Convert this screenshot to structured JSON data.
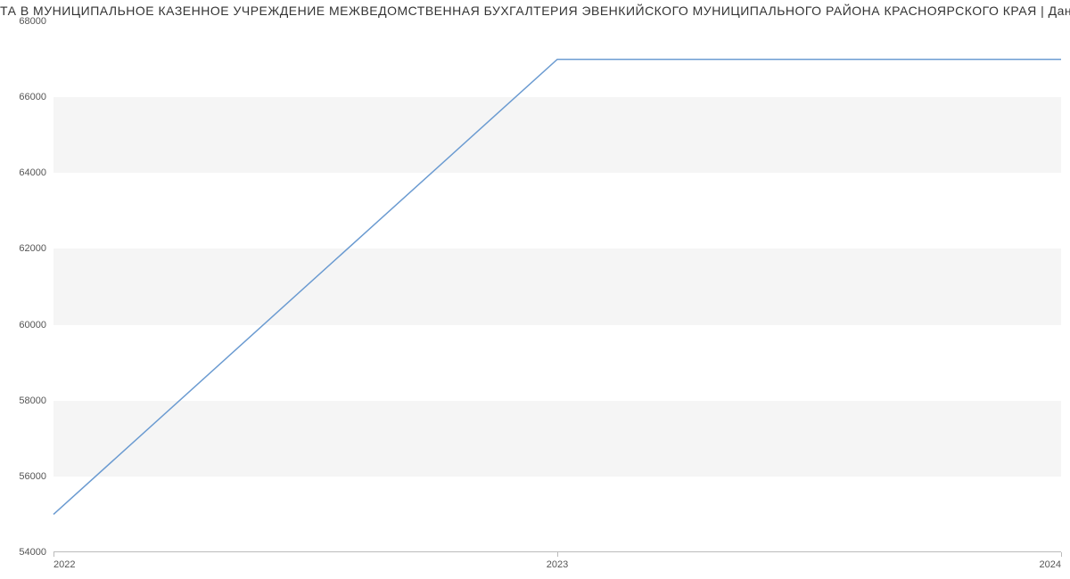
{
  "chart_data": {
    "type": "line",
    "title": "ТА В МУНИЦИПАЛЬНОЕ КАЗЕННОЕ  УЧРЕЖДЕНИЕ МЕЖВЕДОМСТВЕННАЯ БУХГАЛТЕРИЯ ЭВЕНКИЙСКОГО МУНИЦИПАЛЬНОГО РАЙОНА КРАСНОЯРСКОГО КРАЯ | Данные mno",
    "x": [
      2022,
      2023,
      2024
    ],
    "values": [
      55000,
      67000,
      67000
    ],
    "xlabel": "",
    "ylabel": "",
    "xlim": [
      2022,
      2024
    ],
    "ylim": [
      54000,
      68000
    ],
    "y_ticks": [
      54000,
      56000,
      58000,
      60000,
      62000,
      64000,
      66000,
      68000
    ],
    "x_ticks": [
      2022,
      2023,
      2024
    ],
    "line_color": "#6b9bd1"
  }
}
